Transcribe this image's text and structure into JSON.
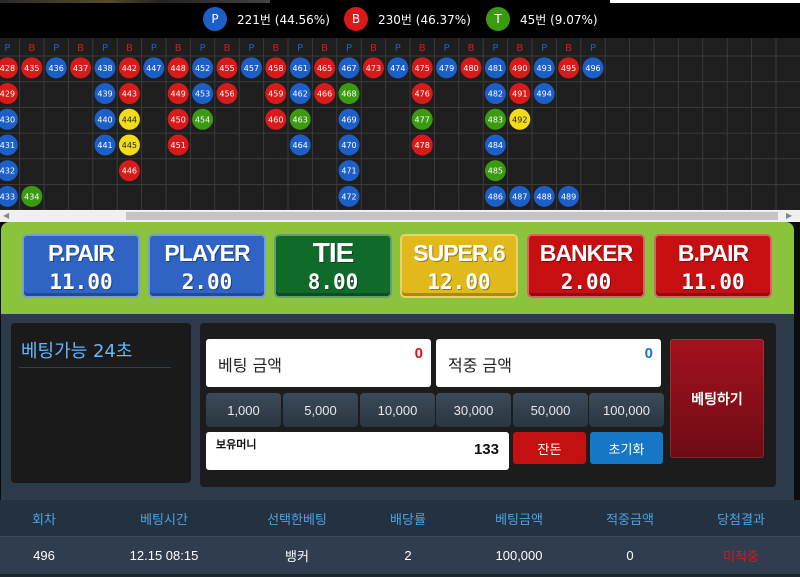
{
  "stats": [
    {
      "badge": "P",
      "text": "221번 (44.56%)",
      "color": "#1c5fc8"
    },
    {
      "badge": "B",
      "text": "230번 (46.37%)",
      "color": "#d91a1a"
    },
    {
      "badge": "T",
      "text": "45번 (9.07%)",
      "color": "#3a9a10"
    }
  ],
  "board": {
    "header": [
      "P",
      "B",
      "P",
      "B",
      "P",
      "B",
      "P",
      "B",
      "P",
      "B",
      "P",
      "B",
      "P",
      "B",
      "P",
      "B",
      "P",
      "B",
      "P",
      "B",
      "P",
      "B",
      "P",
      "B",
      "P"
    ],
    "colors": {
      "P": "#1c5fc8",
      "B": "#d91a1a",
      "T": "#3a9a10",
      "S": "#f2dc1a"
    },
    "cells": [
      {
        "n": "428",
        "c": "B",
        "col": 0,
        "row": 0
      },
      {
        "n": "435",
        "c": "B",
        "col": 1,
        "row": 0
      },
      {
        "n": "436",
        "c": "P",
        "col": 2,
        "row": 0
      },
      {
        "n": "437",
        "c": "B",
        "col": 3,
        "row": 0
      },
      {
        "n": "438",
        "c": "P",
        "col": 4,
        "row": 0
      },
      {
        "n": "442",
        "c": "B",
        "col": 5,
        "row": 0
      },
      {
        "n": "447",
        "c": "P",
        "col": 6,
        "row": 0
      },
      {
        "n": "448",
        "c": "B",
        "col": 7,
        "row": 0
      },
      {
        "n": "452",
        "c": "P",
        "col": 8,
        "row": 0
      },
      {
        "n": "455",
        "c": "B",
        "col": 9,
        "row": 0
      },
      {
        "n": "457",
        "c": "P",
        "col": 10,
        "row": 0
      },
      {
        "n": "458",
        "c": "B",
        "col": 11,
        "row": 0
      },
      {
        "n": "461",
        "c": "P",
        "col": 12,
        "row": 0
      },
      {
        "n": "465",
        "c": "B",
        "col": 13,
        "row": 0
      },
      {
        "n": "467",
        "c": "P",
        "col": 14,
        "row": 0
      },
      {
        "n": "473",
        "c": "B",
        "col": 15,
        "row": 0
      },
      {
        "n": "474",
        "c": "P",
        "col": 16,
        "row": 0
      },
      {
        "n": "475",
        "c": "B",
        "col": 17,
        "row": 0
      },
      {
        "n": "479",
        "c": "P",
        "col": 18,
        "row": 0
      },
      {
        "n": "480",
        "c": "B",
        "col": 19,
        "row": 0
      },
      {
        "n": "481",
        "c": "P",
        "col": 20,
        "row": 0
      },
      {
        "n": "490",
        "c": "B",
        "col": 21,
        "row": 0
      },
      {
        "n": "493",
        "c": "P",
        "col": 22,
        "row": 0
      },
      {
        "n": "495",
        "c": "B",
        "col": 23,
        "row": 0
      },
      {
        "n": "496",
        "c": "P",
        "col": 24,
        "row": 0
      },
      {
        "n": "429",
        "c": "B",
        "col": 0,
        "row": 1
      },
      {
        "n": "439",
        "c": "P",
        "col": 4,
        "row": 1
      },
      {
        "n": "443",
        "c": "B",
        "col": 5,
        "row": 1
      },
      {
        "n": "449",
        "c": "B",
        "col": 7,
        "row": 1
      },
      {
        "n": "453",
        "c": "P",
        "col": 8,
        "row": 1
      },
      {
        "n": "456",
        "c": "B",
        "col": 9,
        "row": 1
      },
      {
        "n": "459",
        "c": "B",
        "col": 11,
        "row": 1
      },
      {
        "n": "462",
        "c": "P",
        "col": 12,
        "row": 1
      },
      {
        "n": "466",
        "c": "B",
        "col": 13,
        "row": 1
      },
      {
        "n": "468",
        "c": "T",
        "col": 14,
        "row": 1
      },
      {
        "n": "476",
        "c": "B",
        "col": 17,
        "row": 1
      },
      {
        "n": "482",
        "c": "P",
        "col": 20,
        "row": 1
      },
      {
        "n": "491",
        "c": "B",
        "col": 21,
        "row": 1
      },
      {
        "n": "494",
        "c": "P",
        "col": 22,
        "row": 1
      },
      {
        "n": "430",
        "c": "P",
        "col": 0,
        "row": 2
      },
      {
        "n": "440",
        "c": "P",
        "col": 4,
        "row": 2
      },
      {
        "n": "444",
        "c": "S",
        "col": 5,
        "row": 2
      },
      {
        "n": "450",
        "c": "B",
        "col": 7,
        "row": 2
      },
      {
        "n": "454",
        "c": "T",
        "col": 8,
        "row": 2
      },
      {
        "n": "460",
        "c": "B",
        "col": 11,
        "row": 2
      },
      {
        "n": "463",
        "c": "T",
        "col": 12,
        "row": 2
      },
      {
        "n": "469",
        "c": "P",
        "col": 14,
        "row": 2
      },
      {
        "n": "477",
        "c": "T",
        "col": 17,
        "row": 2
      },
      {
        "n": "483",
        "c": "T",
        "col": 20,
        "row": 2
      },
      {
        "n": "492",
        "c": "S",
        "col": 21,
        "row": 2
      },
      {
        "n": "431",
        "c": "P",
        "col": 0,
        "row": 3
      },
      {
        "n": "441",
        "c": "P",
        "col": 4,
        "row": 3
      },
      {
        "n": "445",
        "c": "S",
        "col": 5,
        "row": 3
      },
      {
        "n": "451",
        "c": "B",
        "col": 7,
        "row": 3
      },
      {
        "n": "464",
        "c": "P",
        "col": 12,
        "row": 3
      },
      {
        "n": "470",
        "c": "P",
        "col": 14,
        "row": 3
      },
      {
        "n": "478",
        "c": "B",
        "col": 17,
        "row": 3
      },
      {
        "n": "484",
        "c": "P",
        "col": 20,
        "row": 3
      },
      {
        "n": "432",
        "c": "P",
        "col": 0,
        "row": 4
      },
      {
        "n": "446",
        "c": "B",
        "col": 5,
        "row": 4
      },
      {
        "n": "471",
        "c": "P",
        "col": 14,
        "row": 4
      },
      {
        "n": "485",
        "c": "T",
        "col": 20,
        "row": 4
      },
      {
        "n": "433",
        "c": "P",
        "col": 0,
        "row": 5
      },
      {
        "n": "434",
        "c": "T",
        "col": 1,
        "row": 5
      },
      {
        "n": "472",
        "c": "P",
        "col": 14,
        "row": 5
      },
      {
        "n": "486",
        "c": "P",
        "col": 20,
        "row": 5
      },
      {
        "n": "487",
        "c": "P",
        "col": 21,
        "row": 5
      },
      {
        "n": "488",
        "c": "P",
        "col": 22,
        "row": 5
      },
      {
        "n": "489",
        "c": "P",
        "col": 23,
        "row": 5
      }
    ]
  },
  "bets": [
    {
      "name": "P.PAIR",
      "odds": "11.00",
      "theme": "tile-blue"
    },
    {
      "name": "PLAYER",
      "odds": "2.00",
      "theme": "tile-blue"
    },
    {
      "name": "TIE",
      "odds": "8.00",
      "theme": "tile-green"
    },
    {
      "name": "SUPER.6",
      "odds": "12.00",
      "theme": "tile-yellow"
    },
    {
      "name": "BANKER",
      "odds": "2.00",
      "theme": "tile-red"
    },
    {
      "name": "B.PAIR",
      "odds": "11.00",
      "theme": "tile-red"
    }
  ],
  "timer": {
    "label": "베팅가능 24초"
  },
  "bet_amount": {
    "label": "베팅 금액",
    "value": "0",
    "color": "#e01010"
  },
  "win_amount": {
    "label": "적중 금액",
    "value": "0",
    "color": "#1670d8"
  },
  "chips": [
    "1,000",
    "5,000",
    "10,000",
    "30,000",
    "50,000",
    "100,000"
  ],
  "money": {
    "label": "보유머니",
    "value": "133"
  },
  "buttons": {
    "balance": "잔돈",
    "reset": "초기화",
    "place_bet": "베팅하기"
  },
  "history": {
    "columns": [
      "회차",
      "베팅시간",
      "선택한베팅",
      "배당률",
      "베팅금액",
      "적중금액",
      "당첨결과"
    ],
    "rows": [
      [
        "496",
        "12.15 08:15",
        "뱅커",
        "2",
        "100,000",
        "0",
        "미적중"
      ]
    ]
  }
}
